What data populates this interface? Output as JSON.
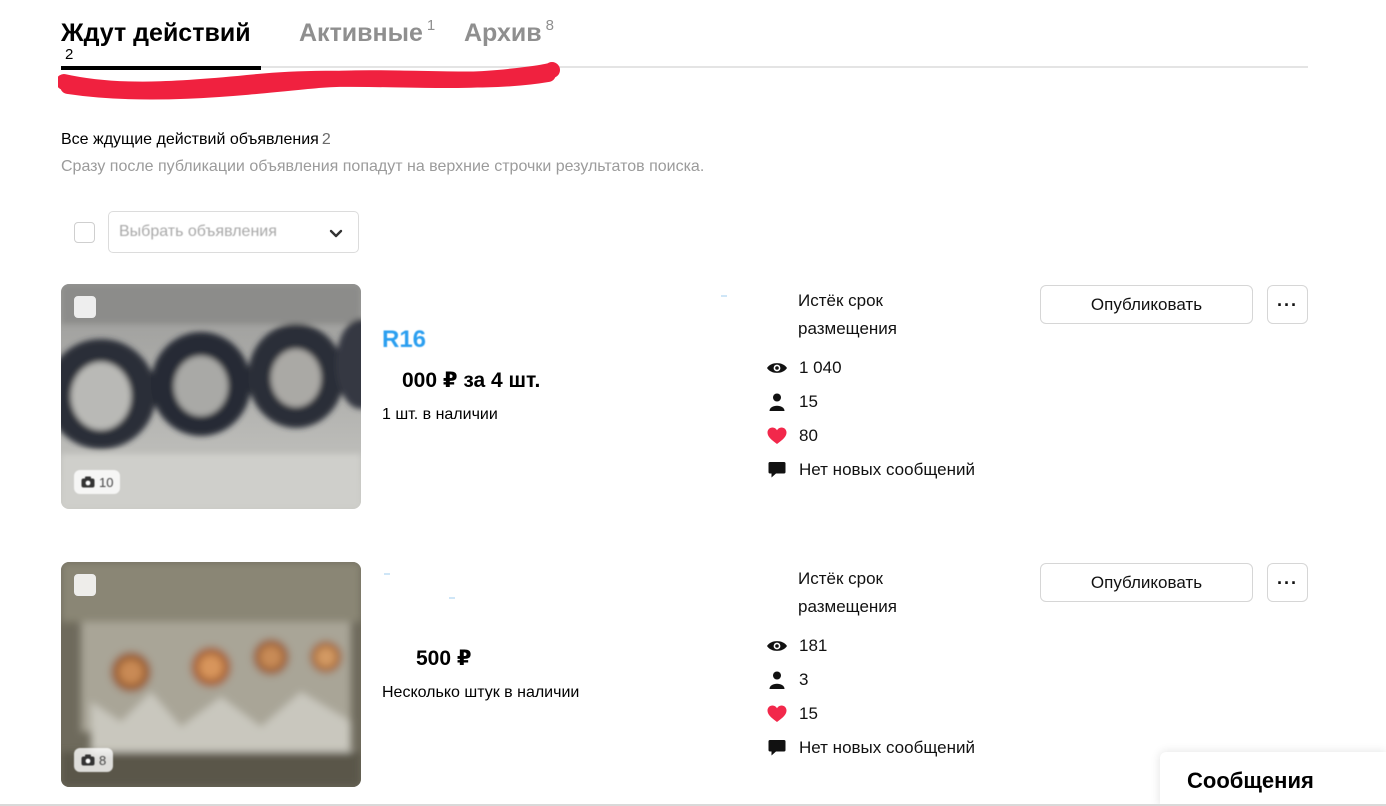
{
  "tabs": [
    {
      "label": "Ждут действий",
      "count": "2",
      "active": true
    },
    {
      "label": "Активные",
      "count": "1",
      "active": false
    },
    {
      "label": "Архив",
      "count": "8",
      "active": false
    }
  ],
  "section": {
    "title": "Все ждущие действий объявления",
    "count": "2",
    "description": "Сразу после публикации объявления попадут на верхние строчки результатов поиска."
  },
  "bulk_select": {
    "placeholder": "Выбрать объявления"
  },
  "listings": [
    {
      "photo_count": "10",
      "title": "R16",
      "price": "000 ₽ за 4 шт.",
      "stock": "1 шт. в наличии",
      "status": "Истёк срок размещения",
      "views": "1 040",
      "contacts": "15",
      "favorites": "80",
      "messages": "Нет новых сообщений",
      "publish_label": "Опубликовать",
      "more_label": "···"
    },
    {
      "photo_count": "8",
      "title": "",
      "price": "500 ₽",
      "stock": "Несколько штук в наличии",
      "status": "Истёк срок размещения",
      "views": "181",
      "contacts": "3",
      "favorites": "15",
      "messages": "Нет новых сообщений",
      "publish_label": "Опубликовать",
      "more_label": "···"
    }
  ],
  "messages_bar": {
    "label": "Сообщения"
  },
  "colors": {
    "accent_title": "#2b9ff0",
    "favorite": "#f2284b",
    "redaction": "#f0213f"
  },
  "icons": [
    "eye-icon",
    "person-icon",
    "heart-icon",
    "chat-bubble-icon",
    "camera-icon",
    "chevron-down-icon"
  ]
}
